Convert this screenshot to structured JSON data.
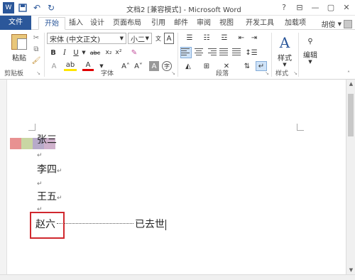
{
  "window": {
    "title": "文档2 [兼容模式] - Microsoft Word",
    "controls": {
      "help": "?",
      "minimize": "—",
      "restore": "▢",
      "close": "✕"
    }
  },
  "qat": {
    "save_icon": "save-icon",
    "undo_icon": "undo-icon",
    "redo_icon": "redo-icon"
  },
  "tabs": [
    "文件",
    "开始",
    "插入",
    "设计",
    "页面布局",
    "引用",
    "邮件",
    "审阅",
    "视图",
    "开发工具",
    "加载项"
  ],
  "user": {
    "name": "胡俊"
  },
  "ribbon": {
    "clipboard": {
      "paste": "粘贴",
      "label": "剪贴板"
    },
    "font": {
      "name": "宋体 (中文正文)",
      "size": "小二",
      "bold": "B",
      "italic": "I",
      "underline": "U",
      "strike": "abc",
      "subscript": "x₂",
      "superscript": "x²",
      "label": "字体"
    },
    "paragraph": {
      "label": "段落"
    },
    "styles": {
      "button": "样式",
      "label": "样式"
    },
    "editing": {
      "button": "编辑"
    }
  },
  "document": {
    "lines": [
      "张三",
      "李四",
      "王五",
      "赵六"
    ],
    "trailing_text": "已去世"
  },
  "colors": {
    "accent": "#2b579a",
    "highlight_border": "#d0282e",
    "swatches": [
      "#e89191",
      "#c9d6a3",
      "#b7aac9",
      "#cfb1cc"
    ]
  }
}
